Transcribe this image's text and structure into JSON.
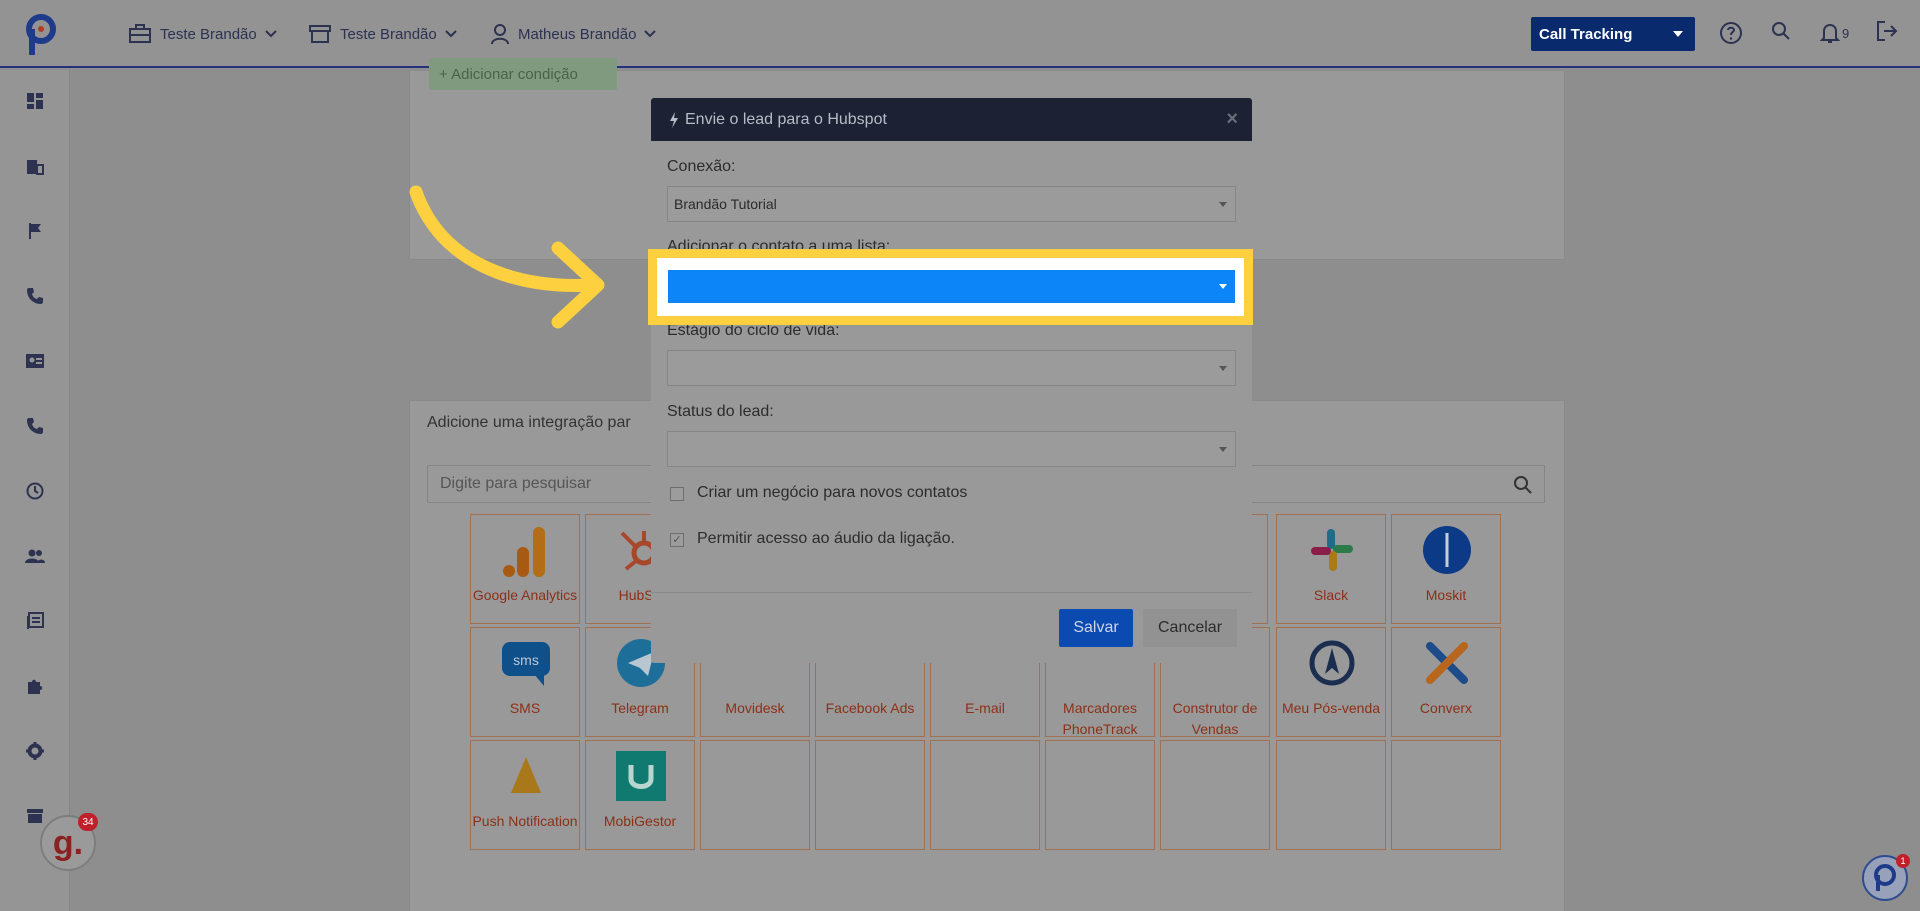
{
  "topbar": {
    "account": "Teste Brandão",
    "store": "Teste Brandão",
    "user": "Matheus Brandão",
    "product_select": "Call Tracking",
    "notifications_count": "9"
  },
  "sidebar": {
    "icons": [
      "dashboard-icon",
      "building-icon",
      "flag-icon",
      "phone-icon",
      "contact-card-icon",
      "phone-icon",
      "clock-icon",
      "users-icon",
      "book-icon",
      "puzzle-icon",
      "gear-icon",
      "store-icon"
    ]
  },
  "background": {
    "add_condition": "+ Adicionar condição",
    "integration_title": "Adicione uma integração par",
    "search_placeholder": "Digite para pesquisar",
    "tiles_row1": [
      "Google Analytics",
      "HubSp",
      "ts",
      "Slack",
      "Moskit"
    ],
    "tiles_row2": [
      "SMS",
      "Telegram",
      "Movidesk",
      "Facebook Ads",
      "E-mail",
      "Marcadores PhoneTrack",
      "Construtor de Vendas",
      "Meu Pós-venda",
      "Converx"
    ],
    "tiles_row3": [
      "Push Notification",
      "MobiGestor"
    ]
  },
  "modal": {
    "title": "Envie o lead para o Hubspot",
    "close": "×",
    "connection_label": "Conexão:",
    "connection_value": "Brandão Tutorial",
    "list_label": "Adicionar o contato a uma lista:",
    "list_value": "",
    "lifecycle_label": "Estágio do ciclo de vida:",
    "lifecycle_value": "",
    "lead_status_label": "Status do lead:",
    "lead_status_value": "",
    "create_deal_label": "Criar um negócio para novos contatos",
    "create_deal_checked": false,
    "audio_access_label": "Permitir acesso ao áudio da ligação.",
    "audio_access_checked": true,
    "save": "Salvar",
    "cancel": "Cancelar"
  },
  "widgets": {
    "g_badge_letter": "g.",
    "g_badge_count": "34",
    "chat_count": "1"
  },
  "colors": {
    "highlight": "#fcd03f",
    "selected_blue": "#0b85f8",
    "brand_navy": "#0a2a6e"
  }
}
